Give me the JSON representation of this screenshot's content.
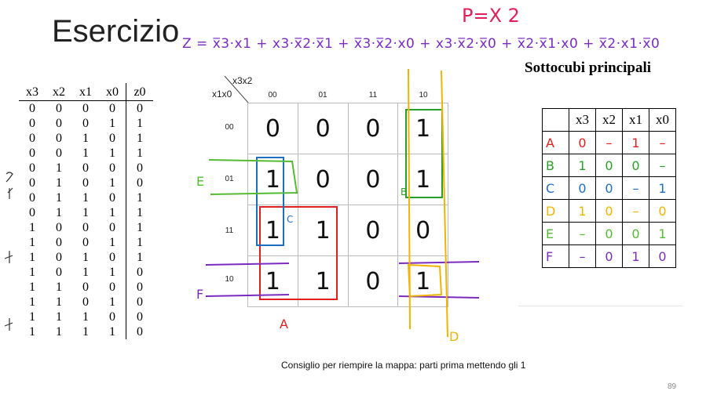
{
  "title": "Esercizio",
  "handwritten_note": "P=X 2",
  "expression": "Z = x̅3·x1 + x3·x̅2·x̅1 + x̅3·x̅2·x0 + x3·x̅2·x̅0 + x̅2·x̅1·x0 + x̅2·x1·x̅0",
  "subtitle": "Sottocubi principali",
  "truth_table": {
    "headers": [
      "x3",
      "x2",
      "x1",
      "x0",
      "z0"
    ],
    "rows": [
      [
        "0",
        "0",
        "0",
        "0",
        "0"
      ],
      [
        "0",
        "0",
        "0",
        "1",
        "1"
      ],
      [
        "0",
        "0",
        "1",
        "0",
        "1"
      ],
      [
        "0",
        "0",
        "1",
        "1",
        "1"
      ],
      [
        "0",
        "1",
        "0",
        "0",
        "0"
      ],
      [
        "0",
        "1",
        "0",
        "1",
        "0"
      ],
      [
        "0",
        "1",
        "1",
        "0",
        "1"
      ],
      [
        "0",
        "1",
        "1",
        "1",
        "1"
      ],
      [
        "1",
        "0",
        "0",
        "0",
        "1"
      ],
      [
        "1",
        "0",
        "0",
        "1",
        "1"
      ],
      [
        "1",
        "0",
        "1",
        "0",
        "1"
      ],
      [
        "1",
        "0",
        "1",
        "1",
        "0"
      ],
      [
        "1",
        "1",
        "0",
        "0",
        "0"
      ],
      [
        "1",
        "1",
        "0",
        "1",
        "0"
      ],
      [
        "1",
        "1",
        "1",
        "0",
        "0"
      ],
      [
        "1",
        "1",
        "1",
        "1",
        "0"
      ]
    ]
  },
  "kmap": {
    "col_var": "x3x2",
    "row_var": "x1x0",
    "col_labels": [
      "00",
      "01",
      "11",
      "10"
    ],
    "row_labels": [
      "00",
      "01",
      "11",
      "10"
    ],
    "cells": [
      [
        "0",
        "0",
        "0",
        "1"
      ],
      [
        "1",
        "0",
        "0",
        "1"
      ],
      [
        "1",
        "1",
        "0",
        "0"
      ],
      [
        "1",
        "1",
        "0",
        "1"
      ]
    ],
    "group_labels": {
      "A": "A",
      "B": "B",
      "C": "C",
      "D": "D",
      "E": "E",
      "F": "F"
    },
    "colors": {
      "A": "#e02020",
      "B": "#2aa02a",
      "C": "#1f6fc0",
      "D": "#f0b400",
      "E": "#55bb33",
      "F": "#7b2cbf"
    }
  },
  "subcubes": {
    "headers": [
      "",
      "x3",
      "x2",
      "x1",
      "x0"
    ],
    "rows": [
      {
        "label": "A",
        "vals": [
          "0",
          "–",
          "1",
          "–"
        ]
      },
      {
        "label": "B",
        "vals": [
          "1",
          "0",
          "0",
          "–"
        ]
      },
      {
        "label": "C",
        "vals": [
          "0",
          "0",
          "–",
          "1"
        ]
      },
      {
        "label": "D",
        "vals": [
          "1",
          "0",
          "–",
          "0"
        ]
      },
      {
        "label": "E",
        "vals": [
          "–",
          "0",
          "0",
          "1"
        ]
      },
      {
        "label": "F",
        "vals": [
          "–",
          "0",
          "1",
          "0"
        ]
      }
    ]
  },
  "hint": "Consiglio per riempire la mappa: parti prima mettendo gli 1",
  "page_number": "89"
}
